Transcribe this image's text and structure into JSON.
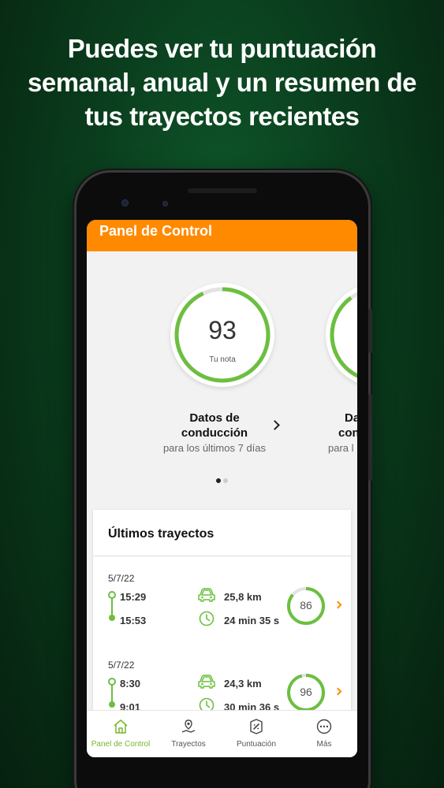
{
  "headline": "Puedes ver tu puntuación semanal, anual y un resumen de tus trayectos recientes",
  "app_bar": {
    "title": "Panel de Control"
  },
  "score_cards": [
    {
      "score": "93",
      "score_label": "Tu nota",
      "title_line1": "Datos de",
      "title_line2": "conducción",
      "subtitle": "para los últimos 7 días",
      "progress": 0.93
    },
    {
      "title_line1": "Da",
      "title_line2": "con",
      "subtitle": "para l",
      "progress": 0.9
    }
  ],
  "pager": {
    "count": 2,
    "active": 0
  },
  "trips_panel": {
    "title": "Últimos trayectos",
    "trips": [
      {
        "date": "5/7/22",
        "start": "15:29",
        "end": "15:53",
        "distance": "25,8 km",
        "duration": "24 min 35 s",
        "score": "86",
        "progress": 0.86
      },
      {
        "date": "5/7/22",
        "start": "8:30",
        "end": "9:01",
        "distance": "24,3 km",
        "duration": "30 min 36 s",
        "score": "96",
        "progress": 0.96
      }
    ]
  },
  "bottom_nav": [
    {
      "label": "Panel de Control",
      "icon": "home-icon",
      "active": true
    },
    {
      "label": "Trayectos",
      "icon": "route-pin-icon",
      "active": false
    },
    {
      "label": "Puntuación",
      "icon": "score-badge-icon",
      "active": false
    },
    {
      "label": "Más",
      "icon": "more-dots-icon",
      "active": false
    }
  ],
  "colors": {
    "accent": "#ff8a00",
    "green": "#6cbf3f",
    "nav_active": "#7ab52b"
  }
}
